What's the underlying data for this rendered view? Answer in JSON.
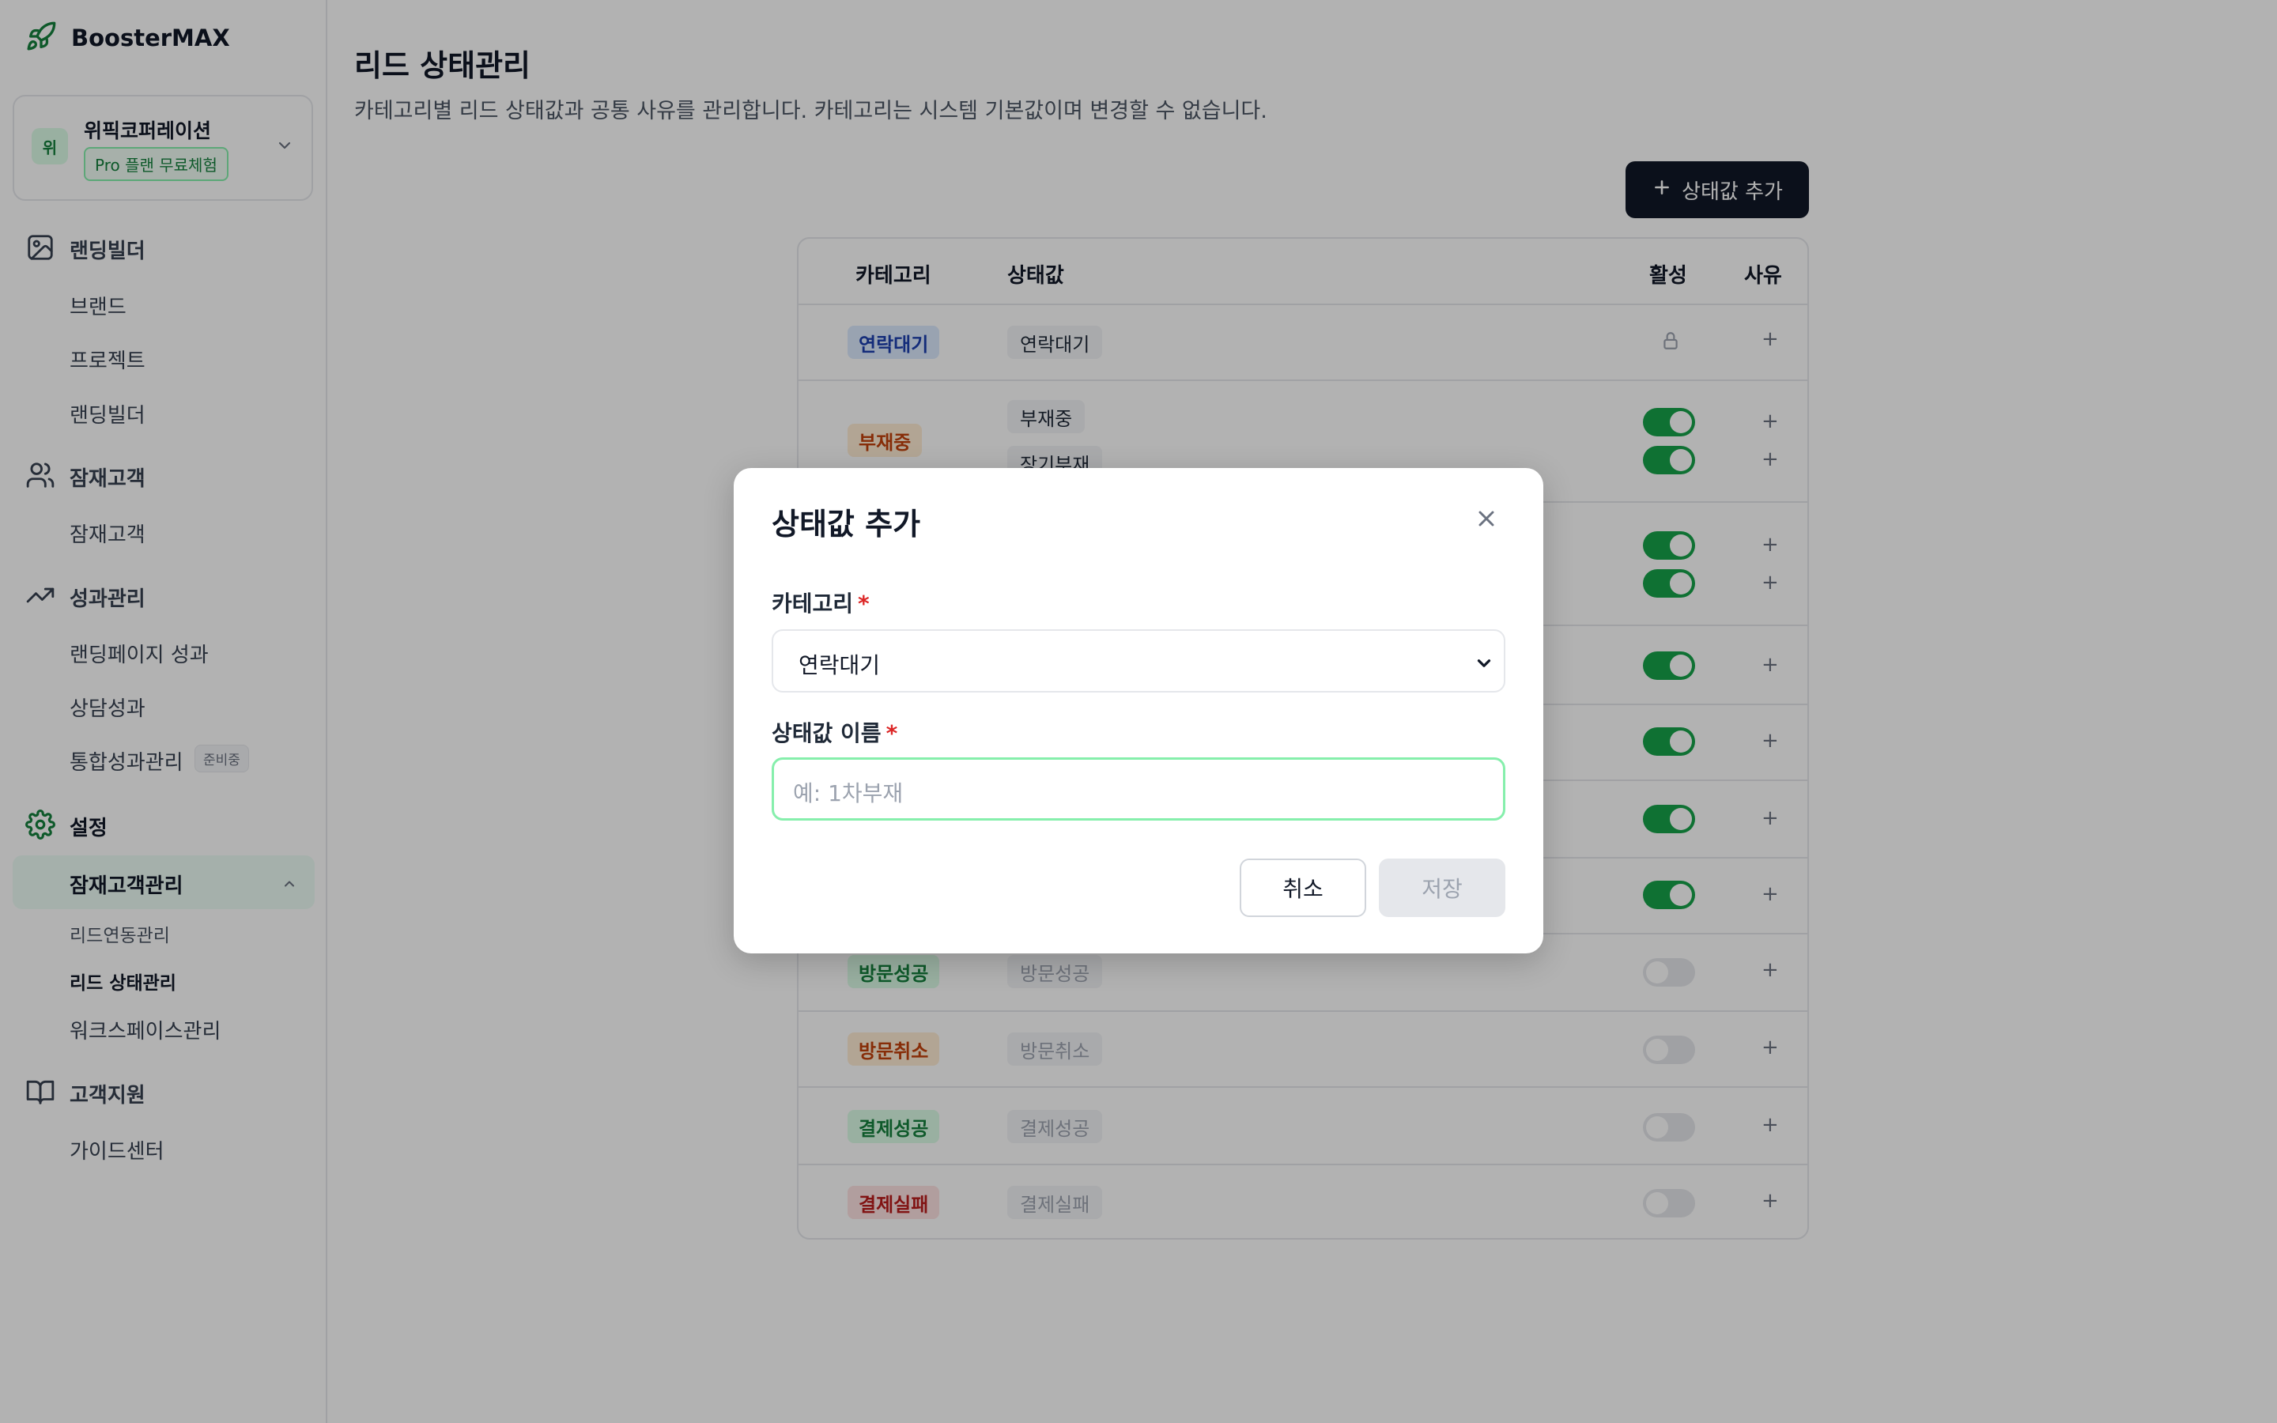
{
  "brand": {
    "name": "BoosterMAX",
    "icon": "rocket-icon",
    "accent": "#16a34a"
  },
  "org": {
    "avatar": "위",
    "name": "위픽코퍼레이션",
    "plan": "Pro 플랜 무료체험"
  },
  "sidebar": {
    "sections": [
      {
        "label": "랜딩빌더",
        "icon": "image-icon",
        "items": [
          "브랜드",
          "프로젝트",
          "랜딩빌더"
        ]
      },
      {
        "label": "잠재고객",
        "icon": "users-icon",
        "items": [
          "잠재고객"
        ]
      },
      {
        "label": "성과관리",
        "icon": "trending-up-icon",
        "items": [
          "랜딩페이지 성과",
          "상담성과",
          "통합성과관리"
        ],
        "badge": "준비중"
      },
      {
        "label": "설정",
        "icon": "gear-icon"
      },
      {
        "label": "고객지원",
        "icon": "book-icon",
        "items": [
          "가이드센터"
        ]
      }
    ],
    "active_group": "잠재고객관리",
    "active_group_items": [
      "리드연동관리",
      "리드 상태관리",
      "워크스페이스관리"
    ],
    "current": "리드 상태관리"
  },
  "page": {
    "title": "리드 상태관리",
    "description": "카테고리별 리드 상태값과 공통 사유를 관리합니다. 카테고리는 시스템 기본값이며 변경할 수 없습니다.",
    "add_button": "상태값 추가"
  },
  "table": {
    "headers": [
      "카테고리",
      "상태값",
      "활성",
      "사유"
    ],
    "rows": [
      {
        "category": "연락대기",
        "statuses": [
          "연락대기"
        ],
        "active": "locked"
      },
      {
        "category": "부재중",
        "statuses": [
          "부재중",
          "장기부재"
        ],
        "active": [
          true,
          true
        ]
      },
      {
        "category": "",
        "statuses": [],
        "active": [
          true,
          true
        ]
      },
      {
        "category": "",
        "statuses": [],
        "active": [
          true
        ]
      },
      {
        "category": "",
        "statuses": [],
        "active": [
          true
        ]
      },
      {
        "category": "",
        "statuses": [],
        "active": [
          true
        ]
      },
      {
        "category": "",
        "statuses": [],
        "active": [
          true
        ]
      },
      {
        "category": "방문성공",
        "statuses": [
          "방문성공"
        ],
        "active": [
          false
        ]
      },
      {
        "category": "방문취소",
        "statuses": [
          "방문취소"
        ],
        "active": [
          false
        ]
      },
      {
        "category": "결제성공",
        "statuses": [
          "결제성공"
        ],
        "active": [
          false
        ]
      },
      {
        "category": "결제실패",
        "statuses": [
          "결제실패"
        ],
        "active": [
          false
        ]
      }
    ],
    "add_reason_symbol": "+"
  },
  "modal": {
    "title": "상태값 추가",
    "category_label": "카테고리",
    "required_mark": "*",
    "category_value": "연락대기",
    "name_label": "상태값 이름",
    "name_placeholder": "예: 1차부재",
    "cancel": "취소",
    "save": "저장"
  },
  "colors": {
    "toggle_on": "#16a34a",
    "primary_button": "#111827",
    "chip_blue": "#dbeafe",
    "chip_orange": "#ffedd5",
    "chip_green": "#dcfce7",
    "chip_red": "#fee2e2"
  }
}
